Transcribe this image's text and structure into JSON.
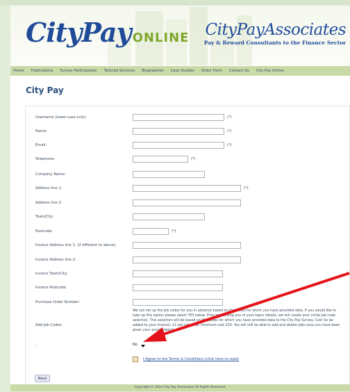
{
  "header": {
    "logo_main": "CityPay",
    "logo_online": "ONLINE",
    "logo_assoc": "CityPayAssociates",
    "logo_tagline": "Pay & Reward Consultants to the Finance Sector"
  },
  "nav": [
    "Home",
    "Publications",
    "Survey Participation",
    "Tailored Services",
    "Biographies",
    "Case Studies",
    "Order Form",
    "Contact Us",
    "City Pay Online"
  ],
  "page_title": "City Pay",
  "form": {
    "username": {
      "label": "Username (lower-case only):",
      "value": "",
      "req": "(*)"
    },
    "name": {
      "label": "Name:",
      "value": "",
      "req": "(*)"
    },
    "email": {
      "label": "Email:",
      "value": "",
      "req": "(*)"
    },
    "telephone": {
      "label": "Telephone:",
      "value": "",
      "req": "(*)"
    },
    "company": {
      "label": "Company Name:",
      "value": ""
    },
    "address1": {
      "label": "Address line 1:",
      "value": "",
      "req": "(*)"
    },
    "address2": {
      "label": "Address line 2:",
      "value": ""
    },
    "town": {
      "label": "Town/City:",
      "value": ""
    },
    "postcode": {
      "label": "Postcode:",
      "value": "",
      "req": "(*)"
    },
    "inv_address1": {
      "label": "Invoice Address line 1: (if different to above)",
      "value": ""
    },
    "inv_address2": {
      "label": "Invoice Address line 2:",
      "value": ""
    },
    "inv_town": {
      "label": "Invoice Town/City:",
      "value": ""
    },
    "inv_postcode": {
      "label": "Invoice Postcode:",
      "value": ""
    },
    "po_number": {
      "label": "Purchase Order Number:",
      "value": ""
    },
    "add_job_codes": {
      "label": "Add Job Codes:",
      "description": "We can set up the job codes for you in advance based on the codes for which you have provided data. If you would like to take up this option please select YES below. Prior to advising you of your logon details, we will create your initial job code selection. This selection will be based on the codes for which you have provided data to the City Pay Survey. Cost (to be added to your invoice): £1 per job code, minimum cost £50. You will still be able to add and delete jobs once you have been given your access details."
    },
    "select_label": ":",
    "select_value": "No",
    "terms_label": "I Agree to the Terms & Conditions (click here to read)",
    "next_label": "Next"
  },
  "footer": "Copyright © 2014 City Pay Associates   All Rights Reserved.",
  "colors": {
    "brand_blue": "#1f4b99",
    "brand_green": "#7fa82d",
    "nav_bg": "#c9daa6",
    "annotation_arrow": "#e4121b"
  }
}
